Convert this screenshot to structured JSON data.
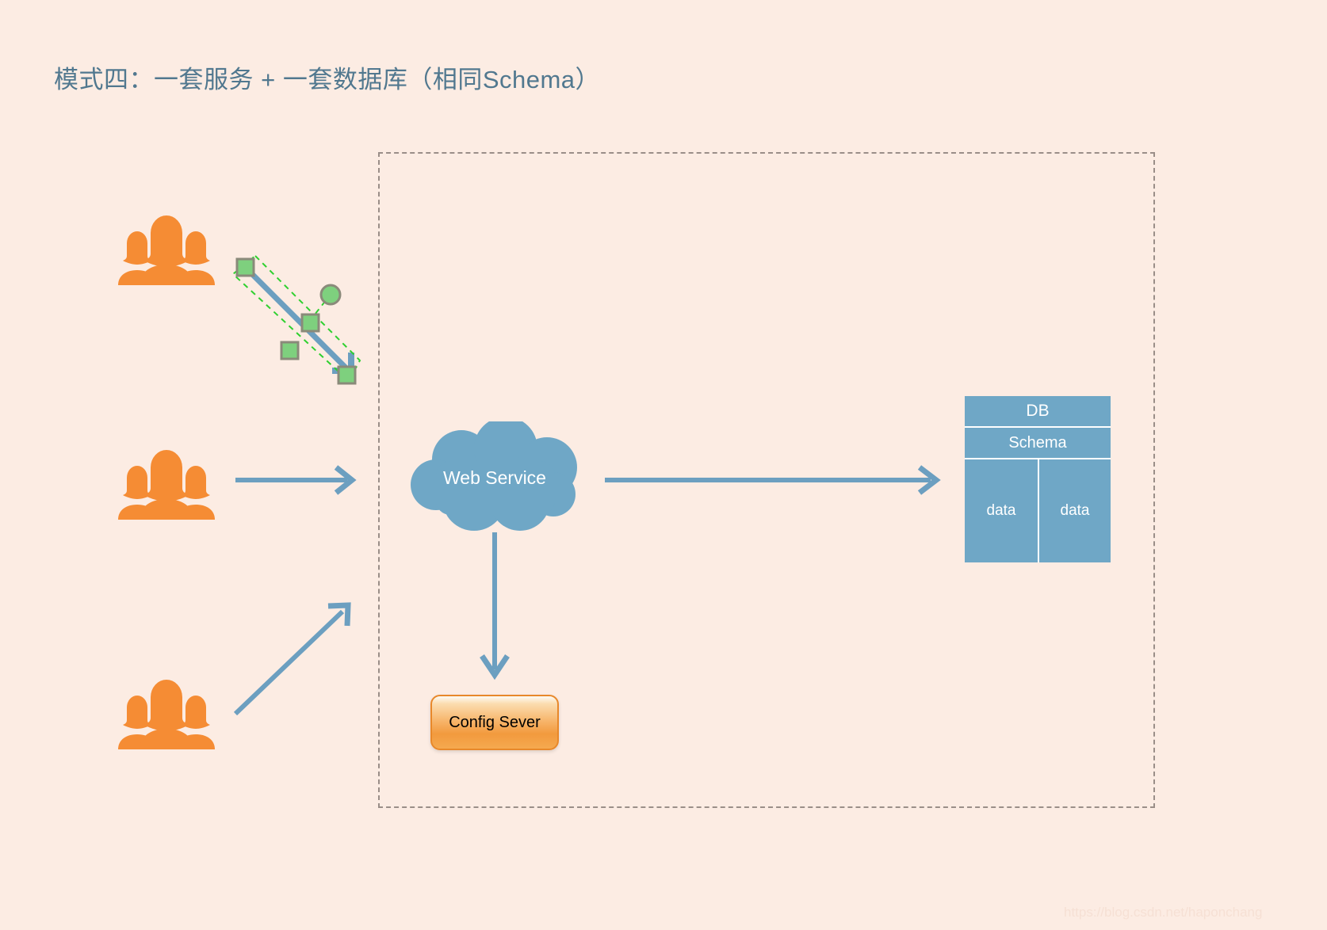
{
  "title": "模式四：一套服务 + 一套数据库（相同Schema）",
  "colors": {
    "background": "#fcece3",
    "title_text": "#51788f",
    "accent_blue": "#6fa7c6",
    "arrow_blue": "#6c9fc0",
    "people_orange": "#f58c34",
    "config_orange": "#f29a3e",
    "boundary_dashed": "#9a8e88",
    "handle_green": "#7ed07e",
    "handle_outline": "#8a8a7a",
    "selection_dash": "#2fd02f",
    "db_divider": "#ffffff",
    "watermark": "#f6e0d4"
  },
  "boundary": {
    "name": "system-boundary",
    "style": "dashed"
  },
  "actors": [
    {
      "id": "users-top",
      "label": "users-group",
      "icon": "people-group-icon"
    },
    {
      "id": "users-middle",
      "label": "users-group",
      "icon": "people-group-icon"
    },
    {
      "id": "users-bottom",
      "label": "users-group",
      "icon": "people-group-icon"
    }
  ],
  "nodes": {
    "web_service": {
      "label": "Web Service",
      "shape": "cloud"
    },
    "config_server": {
      "label": "Config Sever",
      "shape": "rounded-rect"
    },
    "database": {
      "header": "DB",
      "schema": "Schema",
      "cells": [
        "data",
        "data"
      ]
    }
  },
  "connectors": [
    {
      "id": "users-top-to-service",
      "type": "arrow",
      "state": "selected",
      "from": "users-top",
      "to": "web_service"
    },
    {
      "id": "users-middle-to-service",
      "type": "arrow",
      "state": "normal",
      "from": "users-middle",
      "to": "web_service"
    },
    {
      "id": "users-bottom-to-service",
      "type": "arrow",
      "state": "normal",
      "from": "users-bottom",
      "to": "web_service"
    },
    {
      "id": "service-to-database",
      "type": "arrow",
      "state": "normal",
      "from": "web_service",
      "to": "database"
    },
    {
      "id": "service-to-config",
      "type": "arrow",
      "state": "normal",
      "from": "web_service",
      "to": "config_server"
    }
  ],
  "selection": {
    "handle_count": 4,
    "rotation_handle": true
  },
  "watermark": "https://blog.csdn.net/haponchang"
}
